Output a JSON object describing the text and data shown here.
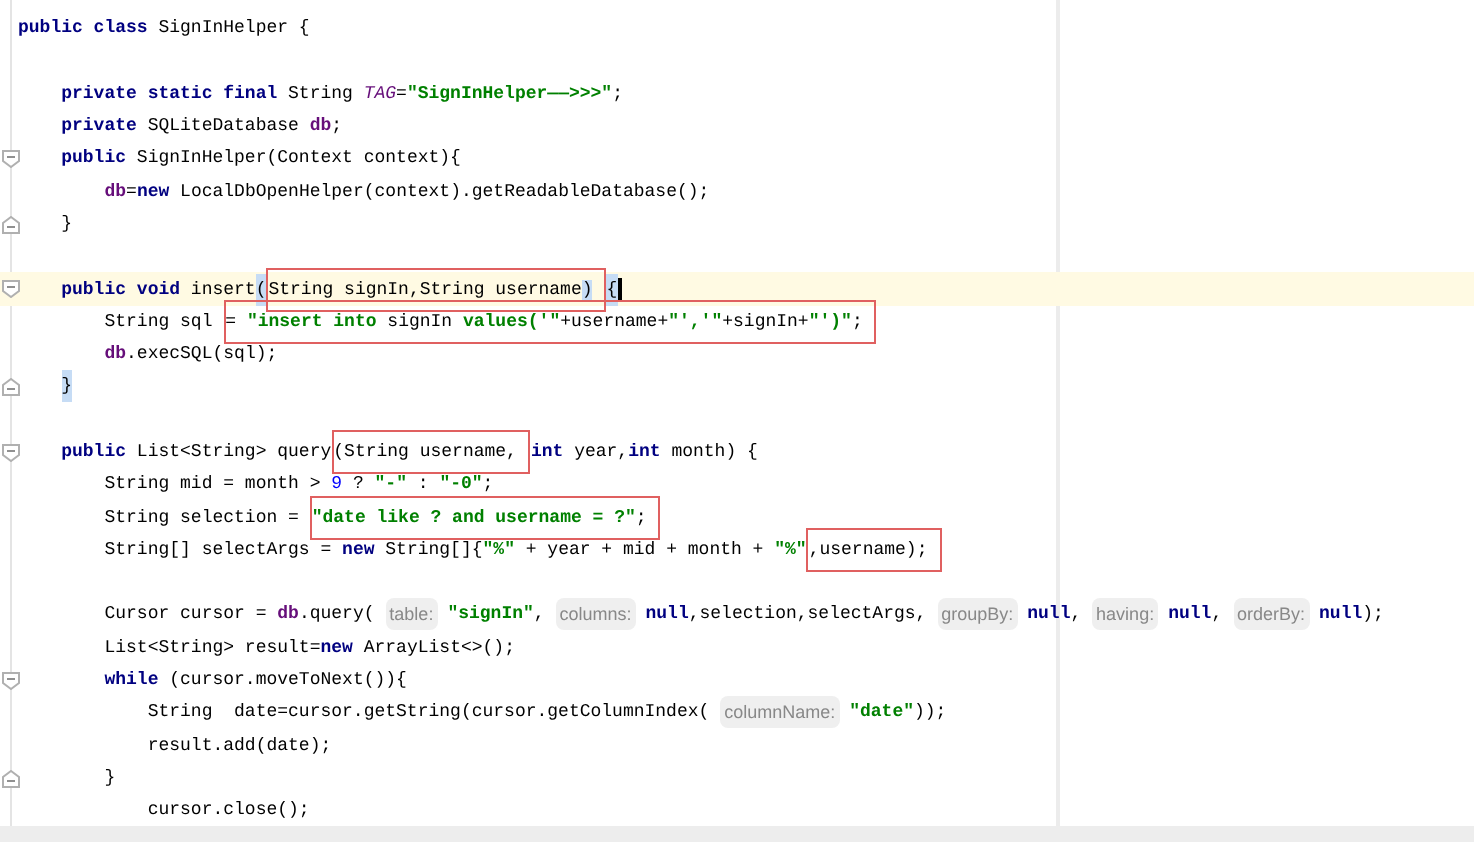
{
  "editor": {
    "lines": [
      {
        "tokens": [
          {
            "kind": "keyword",
            "text": "public class "
          },
          {
            "kind": "plain",
            "text": "SignInHelper {"
          }
        ]
      },
      {
        "gap_before": true,
        "tokens": [
          {
            "kind": "keyword",
            "text": "    private static final "
          },
          {
            "kind": "plain",
            "text": "String "
          },
          {
            "kind": "constant",
            "text": "TAG"
          },
          {
            "kind": "plain",
            "text": "="
          },
          {
            "kind": "string",
            "text": "\"SignInHelper——>>>\""
          },
          {
            "kind": "plain",
            "text": ";"
          }
        ]
      },
      {
        "tokens": [
          {
            "kind": "keyword",
            "text": "    private "
          },
          {
            "kind": "plain",
            "text": "SQLiteDatabase "
          },
          {
            "kind": "field",
            "text": "db"
          },
          {
            "kind": "plain",
            "text": ";"
          }
        ]
      },
      {
        "fold_start": true,
        "tokens": [
          {
            "kind": "keyword",
            "text": "    public "
          },
          {
            "kind": "plain",
            "text": "SignInHelper(Context context){"
          }
        ]
      },
      {
        "tokens": [
          {
            "kind": "field",
            "text": "        db"
          },
          {
            "kind": "plain",
            "text": "="
          },
          {
            "kind": "keyword",
            "text": "new "
          },
          {
            "kind": "plain",
            "text": "LocalDbOpenHelper(context).getReadableDatabase();"
          }
        ]
      },
      {
        "fold_end": true,
        "tokens": [
          {
            "kind": "plain",
            "text": "    }"
          }
        ]
      },
      {
        "gap_before": true,
        "fold_start": true,
        "current": true,
        "caret": true,
        "tokens": [
          {
            "kind": "keyword",
            "text": "    public void "
          },
          {
            "kind": "plain",
            "text": "insert"
          },
          {
            "kind": "plain",
            "text": "(",
            "matched": true
          },
          {
            "kind": "group",
            "boxed": true,
            "tokens": [
              {
                "kind": "plain",
                "text": "String signIn,String username"
              },
              {
                "kind": "plain",
                "text": ")",
                "matched": true
              }
            ]
          },
          {
            "kind": "plain",
            "text": "{",
            "matched": true
          }
        ]
      },
      {
        "tokens": [
          {
            "kind": "plain",
            "text": "        String sql "
          },
          {
            "kind": "group",
            "boxed": true,
            "tokens": [
              {
                "kind": "plain",
                "text": "= "
              },
              {
                "kind": "string",
                "text": "\"insert into "
              },
              {
                "kind": "plain",
                "text": "signIn "
              },
              {
                "kind": "string",
                "text": "values('\""
              },
              {
                "kind": "plain",
                "text": "+username+"
              },
              {
                "kind": "string",
                "text": "\"','\""
              },
              {
                "kind": "plain",
                "text": "+signIn+"
              },
              {
                "kind": "string",
                "text": "\"')\""
              },
              {
                "kind": "plain",
                "text": ";"
              }
            ]
          }
        ]
      },
      {
        "tokens": [
          {
            "kind": "field",
            "text": "        db"
          },
          {
            "kind": "plain",
            "text": ".execSQL(sql);"
          }
        ]
      },
      {
        "fold_end": true,
        "tokens": [
          {
            "kind": "plain",
            "text": "    }",
            "matched": true
          }
        ]
      },
      {
        "gap_before": true,
        "fold_start": true,
        "tokens": [
          {
            "kind": "keyword",
            "text": "    public "
          },
          {
            "kind": "plain",
            "text": "List<String> query"
          },
          {
            "kind": "group",
            "boxed": true,
            "tokens": [
              {
                "kind": "plain",
                "text": "(String username,"
              }
            ]
          },
          {
            "kind": "keyword",
            "text": "int "
          },
          {
            "kind": "plain",
            "text": "year,"
          },
          {
            "kind": "keyword",
            "text": "int "
          },
          {
            "kind": "plain",
            "text": "month) {"
          }
        ]
      },
      {
        "tokens": [
          {
            "kind": "plain",
            "text": "        String mid = month > "
          },
          {
            "kind": "number",
            "text": "9"
          },
          {
            "kind": "plain",
            "text": " ? "
          },
          {
            "kind": "string",
            "text": "\"-\""
          },
          {
            "kind": "plain",
            "text": " : "
          },
          {
            "kind": "string",
            "text": "\"-0\""
          },
          {
            "kind": "plain",
            "text": ";"
          }
        ]
      },
      {
        "tokens": [
          {
            "kind": "plain",
            "text": "        String selection = "
          },
          {
            "kind": "group",
            "boxed": true,
            "tokens": [
              {
                "kind": "string",
                "text": "\"date like ? and username = ?\""
              },
              {
                "kind": "plain",
                "text": ";"
              }
            ]
          }
        ]
      },
      {
        "tokens": [
          {
            "kind": "plain",
            "text": "        String[] selectArgs = "
          },
          {
            "kind": "keyword",
            "text": "new "
          },
          {
            "kind": "plain",
            "text": "String[]{"
          },
          {
            "kind": "string",
            "text": "\"%\""
          },
          {
            "kind": "plain",
            "text": " + year + mid + month + "
          },
          {
            "kind": "string",
            "text": "\"%\""
          },
          {
            "kind": "group",
            "boxed": true,
            "tokens": [
              {
                "kind": "plain",
                "text": ",username);"
              }
            ]
          }
        ]
      },
      {
        "gap_before": true,
        "tokens": [
          {
            "kind": "plain",
            "text": "        Cursor cursor = "
          },
          {
            "kind": "field",
            "text": "db"
          },
          {
            "kind": "plain",
            "text": ".query( "
          },
          {
            "kind": "hint",
            "text": "table:"
          },
          {
            "kind": "string",
            "text": "\"signIn\""
          },
          {
            "kind": "plain",
            "text": ", "
          },
          {
            "kind": "hint",
            "text": "columns:"
          },
          {
            "kind": "keyword",
            "text": "null"
          },
          {
            "kind": "plain",
            "text": ",selection,selectArgs, "
          },
          {
            "kind": "hint",
            "text": "groupBy:"
          },
          {
            "kind": "keyword",
            "text": "null"
          },
          {
            "kind": "plain",
            "text": ", "
          },
          {
            "kind": "hint",
            "text": "having:"
          },
          {
            "kind": "keyword",
            "text": "null"
          },
          {
            "kind": "plain",
            "text": ", "
          },
          {
            "kind": "hint",
            "text": "orderBy:"
          },
          {
            "kind": "keyword",
            "text": "null"
          },
          {
            "kind": "plain",
            "text": ");"
          }
        ]
      },
      {
        "tokens": [
          {
            "kind": "plain",
            "text": "        List<String> result="
          },
          {
            "kind": "keyword",
            "text": "new "
          },
          {
            "kind": "plain",
            "text": "ArrayList<>();"
          }
        ]
      },
      {
        "fold_start": true,
        "tokens": [
          {
            "kind": "keyword",
            "text": "        while "
          },
          {
            "kind": "plain",
            "text": "(cursor.moveToNext()){"
          }
        ]
      },
      {
        "tokens": [
          {
            "kind": "plain",
            "text": "            String  date=cursor.getString(cursor.getColumnIndex( "
          },
          {
            "kind": "hint",
            "text": "columnName:"
          },
          {
            "kind": "string",
            "text": "\"date\""
          },
          {
            "kind": "plain",
            "text": "));"
          }
        ]
      },
      {
        "tokens": [
          {
            "kind": "plain",
            "text": "            result.add(date);"
          }
        ]
      },
      {
        "fold_end": true,
        "tokens": [
          {
            "kind": "plain",
            "text": "        }"
          }
        ]
      },
      {
        "tokens": [
          {
            "kind": "plain",
            "text": "            cursor.close();"
          }
        ]
      }
    ]
  }
}
